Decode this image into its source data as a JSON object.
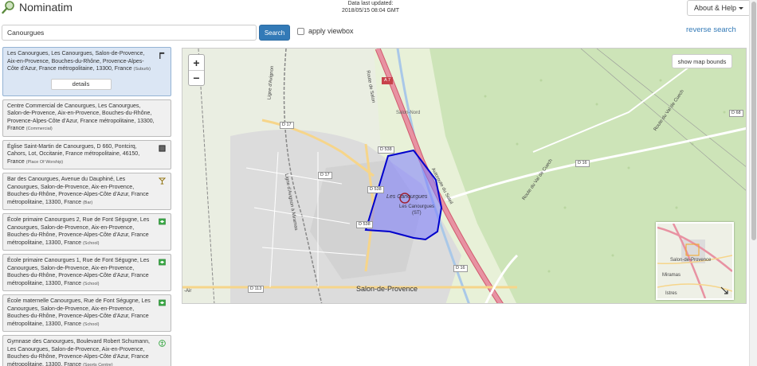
{
  "header": {
    "app_name": "Nominatim",
    "last_updated_line1": "Data last updated:",
    "last_updated_line2": "2018/05/15 08:04 GMT",
    "about_label": "About & Help"
  },
  "search": {
    "query": "Canourgues",
    "button_label": "Search",
    "viewbox_label": "apply viewbox",
    "viewbox_checked": false,
    "reverse_label": "reverse search"
  },
  "results": [
    {
      "text": "Les Canourgues, Les Canourgues, Salon-de-Provence, Aix-en-Provence, Bouches-du-Rhône, Provence-Alpes-Côte d'Azur, France métropolitaine, 13300, France",
      "type": "(Suburb)",
      "icon": "flag-icon",
      "selected": true,
      "details_label": "details"
    },
    {
      "text": "Centre Commercial de Canourgues, Les Canourgues, Salon-de-Provence, Aix-en-Provence, Bouches-du-Rhône, Provence-Alpes-Côte d'Azur, France métropolitaine, 13300, France",
      "type": "(Commercial)",
      "icon": "",
      "selected": false
    },
    {
      "text": "Église Saint-Martin de Canourgues, D 660, Pontcirq, Cahors, Lot, Occitanie, France métropolitaine, 46150, France",
      "type": "(Place Of Worship)",
      "icon": "place-of-worship-icon",
      "selected": false
    },
    {
      "text": "Bar des Canourgues, Avenue du Dauphiné, Les Canourgues, Salon-de-Provence, Aix-en-Provence, Bouches-du-Rhône, Provence-Alpes-Côte d'Azur, France métropolitaine, 13300, France",
      "type": "(Bar)",
      "icon": "bar-icon",
      "selected": false
    },
    {
      "text": "École primaire Canourgues 2, Rue de Font Ségugne, Les Canourgues, Salon-de-Provence, Aix-en-Provence, Bouches-du-Rhône, Provence-Alpes-Côte d'Azur, France métropolitaine, 13300, France",
      "type": "(School)",
      "icon": "school-icon",
      "selected": false
    },
    {
      "text": "École primaire Canourgues 1, Rue de Font Ségugne, Les Canourgues, Salon-de-Provence, Aix-en-Provence, Bouches-du-Rhône, Provence-Alpes-Côte d'Azur, France métropolitaine, 13300, France",
      "type": "(School)",
      "icon": "school-icon",
      "selected": false
    },
    {
      "text": "École maternelle Canourgues, Rue de Font Ségugne, Les Canourgues, Salon-de-Provence, Aix-en-Provence, Bouches-du-Rhône, Provence-Alpes-Côte d'Azur, France métropolitaine, 13300, France",
      "type": "(School)",
      "icon": "school-icon",
      "selected": false
    },
    {
      "text": "Gymnase des Canourgues, Boulevard Robert Schumann, Les Canourgues, Salon-de-Provence, Aix-en-Provence, Bouches-du-Rhône, Provence-Alpes-Côte d'Azur, France métropolitaine, 13300, France",
      "type": "(Sports Centre)",
      "icon": "sports-centre-icon",
      "selected": false
    }
  ],
  "map": {
    "zoom_in": "+",
    "zoom_out": "−",
    "show_bounds_label": "show map bounds",
    "city_label": "Salon-de-Provence",
    "area_label": "Les Canourgues",
    "area_sublabel": "Les Canourgues",
    "area_sublabel2": "(ST)",
    "road_labels": {
      "a7": "A 7",
      "d17a": "D 17",
      "d17b": "D 17",
      "d538a": "D 538",
      "d538b": "D 538",
      "d538c": "D 538",
      "d16a": "D 16",
      "d16b": "D 16",
      "d113": "D 113",
      "d68": "D 68"
    },
    "place_labels": {
      "salon_nord": "Salon-Nord",
      "route_val": "Route du Val de Cuech",
      "route_val2": "Route du Val de Cuech",
      "autoroute": "Autoroute du Soleil",
      "route_salon": "Route de Salon",
      "ligne_avignon": "Ligne d'Avignon",
      "ligne_avignon2": "Ligne d'Avignon à Miramas",
      "air": "-Air"
    },
    "minimap": {
      "city": "Salon-de-Provence",
      "town": "Miramas",
      "town2": "Istres"
    },
    "colors": {
      "polygon_fill": "#7b7bff",
      "polygon_stroke": "#0000cc",
      "motorway": "#e892a2"
    }
  }
}
